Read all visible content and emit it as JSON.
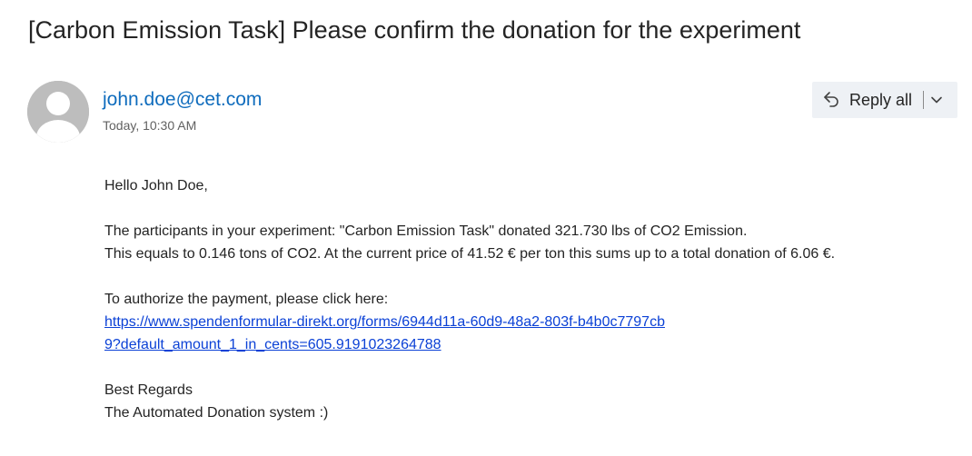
{
  "email": {
    "subject": "[Carbon Emission Task] Please confirm the donation for the experiment",
    "sender": "john.doe@cet.com",
    "timestamp": "Today, 10:30 AM",
    "actions": {
      "reply_all_label": "Reply all",
      "reply_icon": "reply-all-icon",
      "more_icon": "chevron-down-icon"
    },
    "body": {
      "greeting": "Hello John Doe,",
      "line1": "The participants in your experiment: \"Carbon Emission Task\" donated 321.730 lbs of CO2 Emission.",
      "line2": "This equals to 0.146 tons of CO2. At the current price of 41.52 € per ton this sums up to a total donation of 6.06 €.",
      "authorize_text": "To authorize the payment, please click here:",
      "payment_link": "https://www.spendenformular-direkt.org/forms/6944d11a-60d9-48a2-803f-b4b0c7797cb9?default_amount_1_in_cents=605.9191023264788",
      "regards": "Best Regards",
      "signature": "The Automated Donation system :)"
    },
    "colors": {
      "sender": "#0f6cbd",
      "link": "#0b41d6",
      "avatar": "#bdbdbd",
      "button_bg": "#eef1f5"
    }
  }
}
